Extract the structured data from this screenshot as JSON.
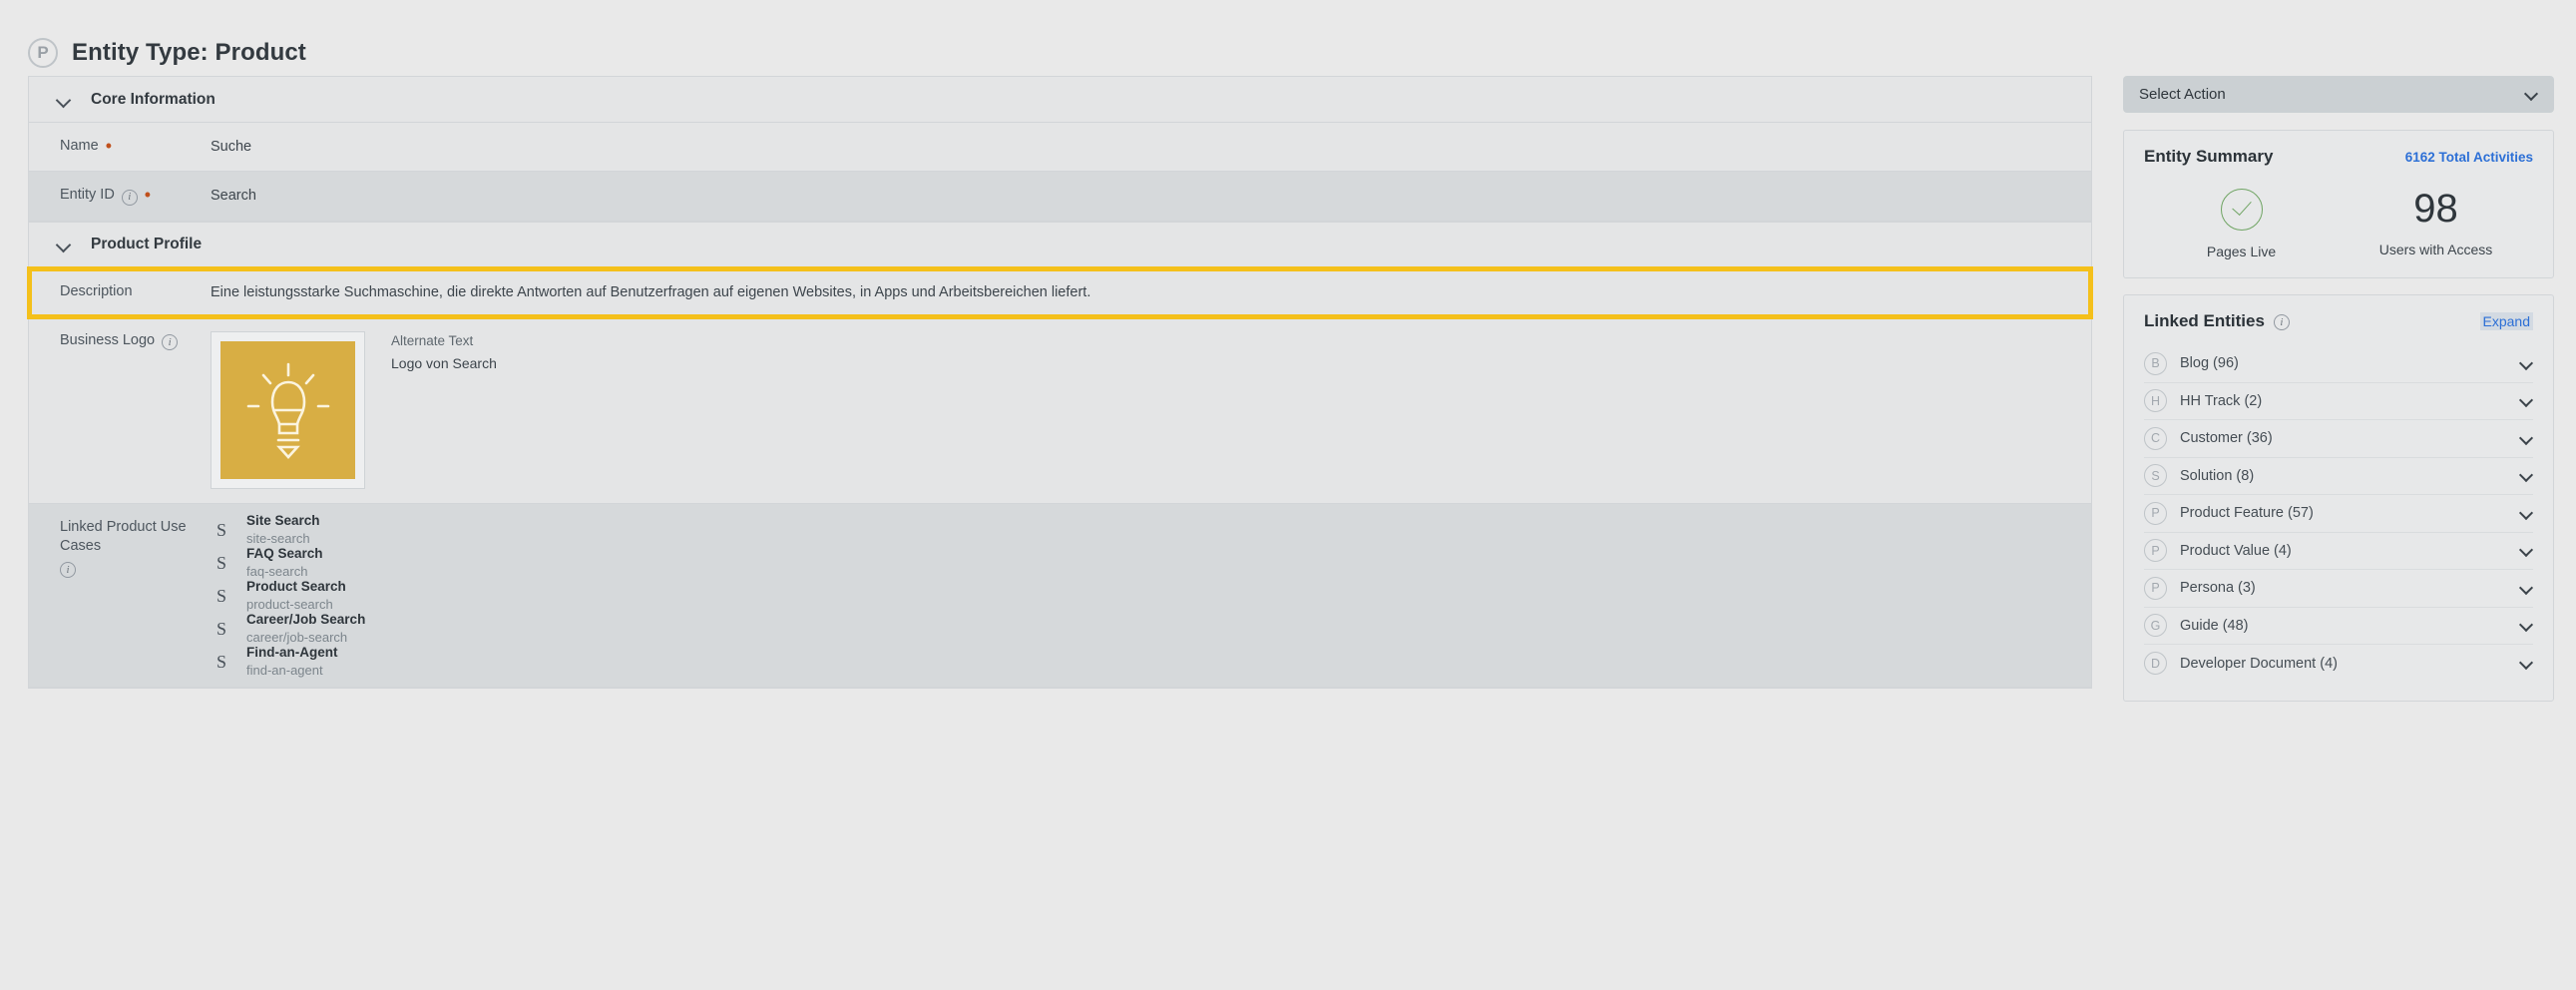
{
  "header": {
    "badge": "P",
    "badge_icon": "circled-letter-p-icon",
    "title": "Entity Type: Product"
  },
  "main": {
    "sections": [
      {
        "id": "core-information",
        "title": "Core Information",
        "collapse_icon": "chevron-down-icon"
      },
      {
        "id": "product-profile",
        "title": "Product Profile",
        "collapse_icon": "chevron-down-icon"
      }
    ],
    "core_information": {
      "name": {
        "label": "Name",
        "required": true,
        "value": "Suche"
      },
      "entity_id": {
        "label": "Entity ID",
        "required": true,
        "has_info": true,
        "value": "Search"
      }
    },
    "product_profile": {
      "description": {
        "label": "Description",
        "value": "Eine leistungsstarke Suchmaschine, die direkte Antworten auf Benutzerfragen auf eigenen Websites, in Apps und Arbeitsbereichen liefert.",
        "highlighted": true,
        "highlight_color": "#F4C01B"
      },
      "business_logo": {
        "label": "Business Logo",
        "has_info": true,
        "image_icon": "lightbulb-icon",
        "image_bg": "#D8AE44",
        "alt_label": "Alternate Text",
        "alt_value": "Logo von Search"
      },
      "linked_product_use_cases": {
        "label": "Linked Product Use Cases",
        "has_info": true,
        "items": [
          {
            "avatar": "S",
            "title": "Site Search",
            "slug": "site-search"
          },
          {
            "avatar": "S",
            "title": "FAQ Search",
            "slug": "faq-search"
          },
          {
            "avatar": "S",
            "title": "Product Search",
            "slug": "product-search"
          },
          {
            "avatar": "S",
            "title": "Career/Job Search",
            "slug": "career/job-search"
          },
          {
            "avatar": "S",
            "title": "Find-an-Agent",
            "slug": "find-an-agent"
          }
        ]
      }
    }
  },
  "sidebar": {
    "action_select": {
      "label": "Select Action",
      "chevron_icon": "chevron-down-icon"
    },
    "entity_summary": {
      "title": "Entity Summary",
      "total_activities": "6162 Total Activities",
      "stats": [
        {
          "type": "check",
          "icon": "check-circle-icon",
          "value": "",
          "label": "Pages Live",
          "color": "#6FA463"
        },
        {
          "type": "number",
          "value": "98",
          "label": "Users with Access"
        }
      ]
    },
    "linked_entities": {
      "title": "Linked Entities",
      "has_info": true,
      "expand_label": "Expand",
      "expand_selected": true,
      "link_color": "#2C6FD6",
      "items": [
        {
          "badge": "B",
          "label": "Blog (96)",
          "chevron_icon": "chevron-down-icon"
        },
        {
          "badge": "H",
          "label": "HH Track (2)",
          "chevron_icon": "chevron-down-icon"
        },
        {
          "badge": "C",
          "label": "Customer (36)",
          "chevron_icon": "chevron-down-icon"
        },
        {
          "badge": "S",
          "label": "Solution (8)",
          "chevron_icon": "chevron-down-icon"
        },
        {
          "badge": "P",
          "label": "Product Feature (57)",
          "chevron_icon": "chevron-down-icon"
        },
        {
          "badge": "P",
          "label": "Product Value (4)",
          "chevron_icon": "chevron-down-icon"
        },
        {
          "badge": "P",
          "label": "Persona (3)",
          "chevron_icon": "chevron-down-icon"
        },
        {
          "badge": "G",
          "label": "Guide (48)",
          "chevron_icon": "chevron-down-icon"
        },
        {
          "badge": "D",
          "label": "Developer Document (4)",
          "chevron_icon": "chevron-down-icon"
        }
      ]
    }
  }
}
